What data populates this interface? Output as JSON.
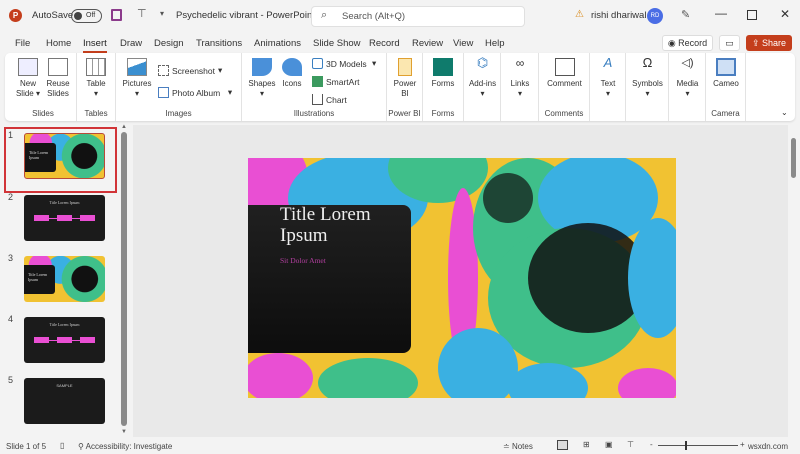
{
  "titlebar": {
    "logo": "P",
    "autosave_label": "AutoSave",
    "autosave_state": "Off",
    "doc_title": "Psychedelic vibrant  -  PowerPoint",
    "search_placeholder": "Search (Alt+Q)",
    "user_name": "rishi dhariwal",
    "user_initials": "RD"
  },
  "tabs": [
    "File",
    "Home",
    "Insert",
    "Draw",
    "Design",
    "Transitions",
    "Animations",
    "Slide Show",
    "Record",
    "Review",
    "View",
    "Help"
  ],
  "active_tab": "Insert",
  "actions": {
    "record": "Record",
    "share": "Share"
  },
  "ribbon": {
    "groups": [
      {
        "label": "Slides",
        "buttons": [
          "New Slide",
          "Reuse Slides"
        ]
      },
      {
        "label": "Tables",
        "buttons": [
          "Table"
        ]
      },
      {
        "label": "Images",
        "buttons": [
          "Pictures",
          "Screenshot",
          "Photo Album"
        ]
      },
      {
        "label": "Illustrations",
        "buttons": [
          "Shapes",
          "Icons",
          "3D Models",
          "SmartArt",
          "Chart"
        ]
      },
      {
        "label": "Power BI",
        "buttons": [
          "Power BI"
        ]
      },
      {
        "label": "Forms",
        "buttons": [
          "Forms"
        ]
      },
      {
        "label": "",
        "buttons": [
          "Add-ins"
        ]
      },
      {
        "label": "",
        "buttons": [
          "Links"
        ]
      },
      {
        "label": "Comments",
        "buttons": [
          "Comment"
        ]
      },
      {
        "label": "",
        "buttons": [
          "Text"
        ]
      },
      {
        "label": "",
        "buttons": [
          "Symbols"
        ]
      },
      {
        "label": "",
        "buttons": [
          "Media"
        ]
      },
      {
        "label": "Camera",
        "buttons": [
          "Cameo"
        ]
      }
    ]
  },
  "thumbnails": [
    {
      "num": "1",
      "title": "Title Lorem Ipsum"
    },
    {
      "num": "2",
      "title": "Title Lorem Ipsum"
    },
    {
      "num": "3",
      "title": "Title Lorem Ipsum"
    },
    {
      "num": "4",
      "title": "Title Lorem Ipsum"
    },
    {
      "num": "5",
      "title": "SAMPLE"
    }
  ],
  "slide": {
    "title_line1": "Title Lorem",
    "title_line2": "Ipsum",
    "subtitle": "Sit Dolor Amet"
  },
  "status": {
    "slide_info": "Slide 1 of 5",
    "accessibility": "Accessibility: Investigate",
    "notes": "Notes",
    "watermark": "wsxdn.com"
  },
  "colors": {
    "accent": "#c43e1c",
    "pink": "#e94fd3",
    "yellow": "#f1c232",
    "blue": "#3ab0e2",
    "green": "#3fbf8a"
  }
}
